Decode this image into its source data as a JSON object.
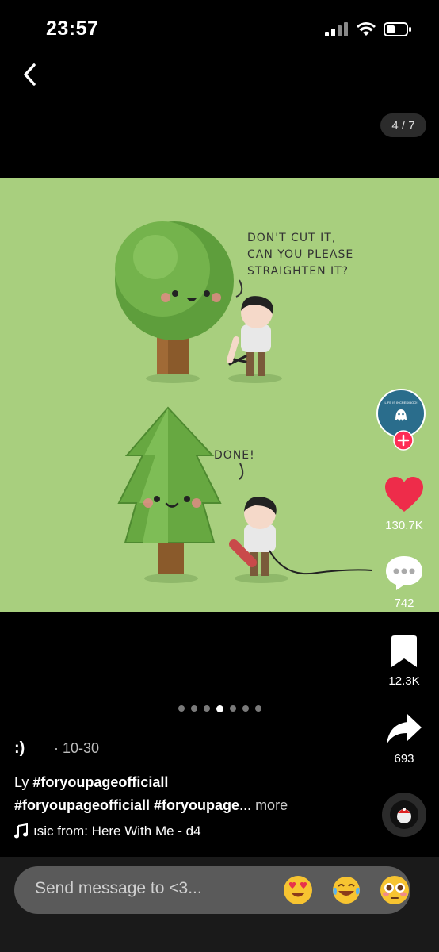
{
  "status": {
    "time": "23:57"
  },
  "viewer": {
    "counter": "4 / 7"
  },
  "comic": {
    "panel1_speech": "DON'T CUT IT,\nCAN YOU PLEASE\nSTRAIGHTEN IT?",
    "panel2_speech": "DONE!"
  },
  "creator": {
    "avatar_text": "LIFE IS INCREDIBOO!"
  },
  "actions": {
    "likes": "130.7K",
    "comments": "742",
    "saves": "12.3K",
    "shares": "693"
  },
  "carousel": {
    "total": 7,
    "active_index": 4
  },
  "post": {
    "author": ":)",
    "date": "· 10-30",
    "caption_prefix": "Ly ",
    "caption_line1_tags": "#foryoupageofficiall",
    "caption_line2_tags": "#foryoupageofficiall #foryoupage",
    "caption_ellipsis": "...",
    "more_label": " more",
    "music": "ısic from: Here With Me - d4"
  },
  "composer": {
    "placeholder": "Send message to <3..."
  },
  "colors": {
    "like": "#ee2c4a",
    "follow": "#fe2c55",
    "photo_bg": "#a8cf7e"
  }
}
